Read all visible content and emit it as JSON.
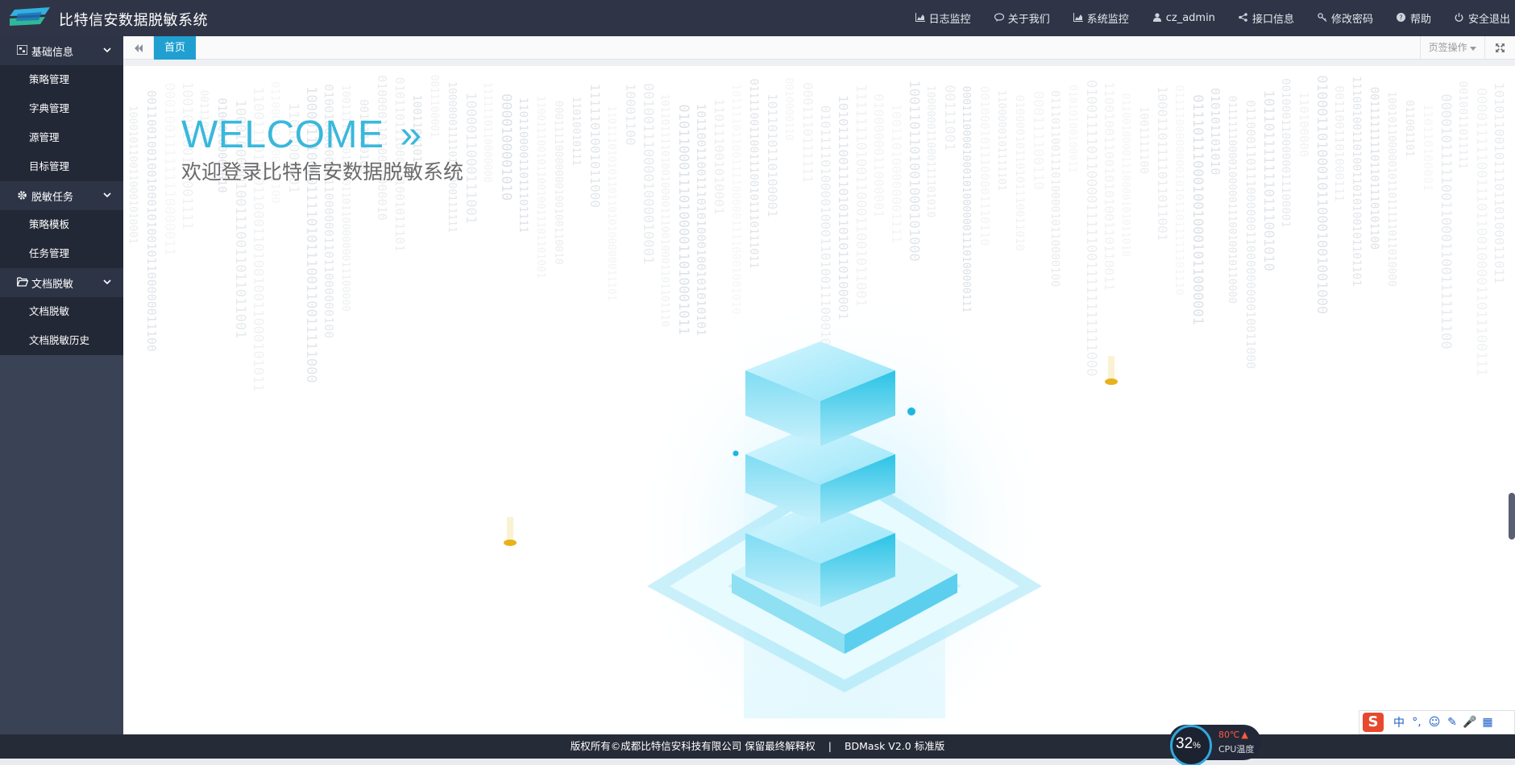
{
  "header": {
    "app_title": "比特信安数据脱敏系统",
    "nav": [
      {
        "label": "日志监控",
        "icon": "area-chart-icon"
      },
      {
        "label": "关于我们",
        "icon": "comment-icon"
      },
      {
        "label": "系统监控",
        "icon": "area-chart-icon"
      },
      {
        "label": "cz_admin",
        "icon": "user-icon"
      },
      {
        "label": "接口信息",
        "icon": "share-icon"
      },
      {
        "label": "修改密码",
        "icon": "key-icon"
      },
      {
        "label": "帮助",
        "icon": "question-circle-icon"
      },
      {
        "label": "安全退出",
        "icon": "power-icon"
      }
    ]
  },
  "sidebar": {
    "groups": [
      {
        "label": "基础信息",
        "icon": "sitemap-icon",
        "items": [
          "策略管理",
          "字典管理",
          "源管理",
          "目标管理"
        ]
      },
      {
        "label": "脱敏任务",
        "icon": "gear-icon",
        "items": [
          "策略模板",
          "任务管理"
        ]
      },
      {
        "label": "文档脱敏",
        "icon": "folder-open-icon",
        "items": [
          "文档脱敏",
          "文档脱敏历史"
        ]
      }
    ]
  },
  "tabs": {
    "home_label": "首页",
    "page_ops_label": "页签操作"
  },
  "main": {
    "welcome": "WELCOME",
    "welcome_arrow": "»",
    "subtitle": "欢迎登录比特信安数据脱敏系统"
  },
  "footer": {
    "copyright": "版权所有©成都比特信安科技有限公司 保留最终解释权",
    "separator": "|",
    "version": "BDMask V2.0 标准版"
  },
  "cpu_widget": {
    "percent": "32",
    "percent_unit": "%",
    "temp": "80℃",
    "label": "CPU温度"
  },
  "ime": {
    "logo": "S",
    "buttons": [
      "中",
      "°,",
      "☺",
      "✎",
      "🎤",
      "▦"
    ]
  },
  "colors": {
    "topbar": "#2f3546",
    "sidebar": "#3a4256",
    "accent": "#1fa0d0",
    "welcome": "#3ab8dc"
  }
}
